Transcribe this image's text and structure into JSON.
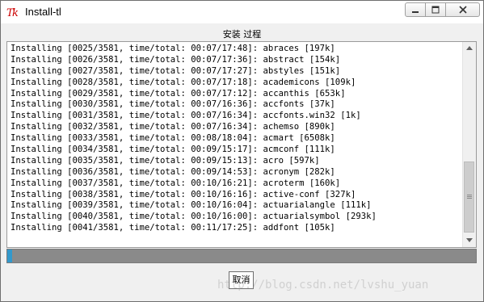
{
  "window": {
    "title": "Install-tl",
    "app_icon": "tk-feather-icon"
  },
  "frame": {
    "label": "安装 过程"
  },
  "log": {
    "lines": [
      "Installing [0025/3581, time/total: 00:07/17:48]: abraces [197k]",
      "Installing [0026/3581, time/total: 00:07/17:36]: abstract [154k]",
      "Installing [0027/3581, time/total: 00:07/17:27]: abstyles [151k]",
      "Installing [0028/3581, time/total: 00:07/17:18]: academicons [109k]",
      "Installing [0029/3581, time/total: 00:07/17:12]: accanthis [653k]",
      "Installing [0030/3581, time/total: 00:07/16:36]: accfonts [37k]",
      "Installing [0031/3581, time/total: 00:07/16:34]: accfonts.win32 [1k]",
      "Installing [0032/3581, time/total: 00:07/16:34]: achemso [890k]",
      "Installing [0033/3581, time/total: 00:08/18:04]: acmart [6508k]",
      "Installing [0034/3581, time/total: 00:09/15:17]: acmconf [111k]",
      "Installing [0035/3581, time/total: 00:09/15:13]: acro [597k]",
      "Installing [0036/3581, time/total: 00:09/14:53]: acronym [282k]",
      "Installing [0037/3581, time/total: 00:10/16:21]: acroterm [160k]",
      "Installing [0038/3581, time/total: 00:10/16:16]: active-conf [327k]",
      "Installing [0039/3581, time/total: 00:10/16:04]: actuarialangle [111k]",
      "Installing [0040/3581, time/total: 00:10/16:00]: actuarialsymbol [293k]",
      "Installing [0041/3581, time/total: 00:11/17:25]: addfont [105k]"
    ]
  },
  "progress": {
    "fraction": 0.011,
    "fill_color": "#3399cc",
    "track_color": "#8a8a8a"
  },
  "buttons": {
    "cancel_label": "取消"
  },
  "watermark": {
    "text": "http://blog.csdn.net/lvshu_yuan"
  }
}
